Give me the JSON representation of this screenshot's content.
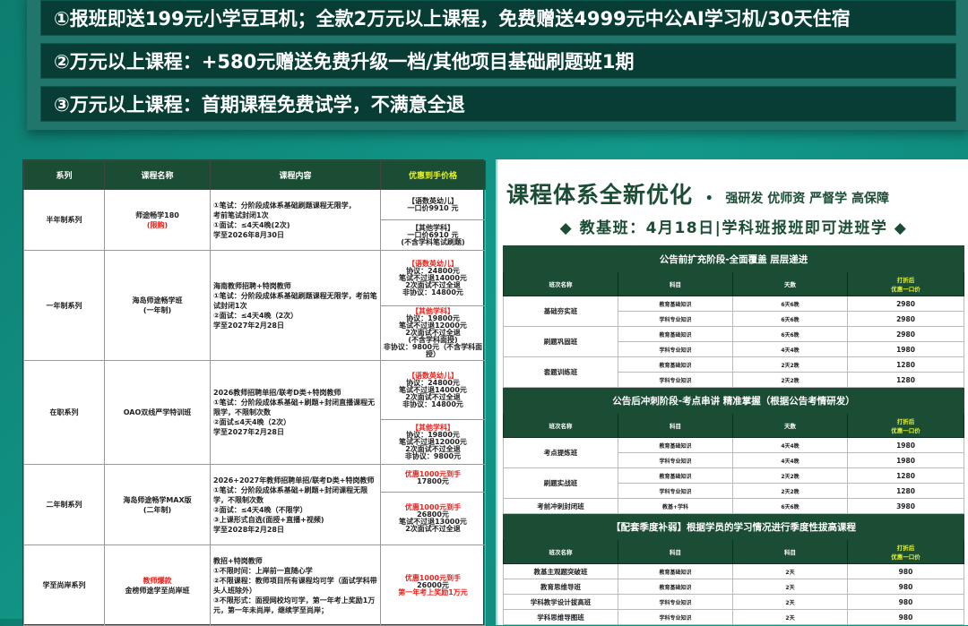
{
  "promo": [
    "①报班即送199元小学豆耳机；全款2万元以上课程，免费赠送4999元中公AI学习机/30天住宿",
    "②万元以上课程：+580元赠送免费升级一档/其他项目基础刷题班1期",
    "③万元以上课程：首期课程免费试学，不满意全退"
  ],
  "left_table": {
    "headers": [
      "系列",
      "课程名称",
      "课程内容",
      "优惠到手价格"
    ],
    "rows": [
      {
        "series": "半年制系列",
        "name": [
          "师途畅学180"
        ],
        "name_red": "(限购)",
        "content": [
          "①笔试：分阶段成体系基础刷题课程无限学，",
          "考前笔试封闭1次",
          "①面试：≤4天4晚(2次)",
          "学至2026年8月30日"
        ],
        "prices": [
          [
            {
              "t": "【语数英幼儿】"
            },
            {
              "t": "一口价9910 元"
            }
          ],
          [
            {
              "t": "【其他学科】"
            },
            {
              "t": "一口价6910 元"
            },
            {
              "t": "(不含学科笔试刷题)"
            }
          ]
        ]
      },
      {
        "series": "一年制系列",
        "name": [
          "海岛师途畅学班",
          "(一年制)"
        ],
        "content": [
          "海南教师招聘+特岗教师",
          "①笔试：分阶段成体系基础刷题课程无限学，考前笔试封闭1次",
          "②面试：≤4天4晚（2次）",
          "学至2027年2月28日"
        ],
        "prices": [
          [
            {
              "t": "【语数英幼儿】",
              "red": true
            },
            {
              "t": "协议：24800元"
            },
            {
              "t": "笔试不过退14000元"
            },
            {
              "t": "2次面试不过全退"
            },
            {
              "t": "非协议：14800元"
            }
          ],
          [
            {
              "t": "【其他学科】",
              "red": true
            },
            {
              "t": "协议：19800元"
            },
            {
              "t": "笔试不过退12000元"
            },
            {
              "t": "2次面试不过全退"
            },
            {
              "t": "(不含学科面授)"
            },
            {
              "t": "非协议：9800元（不含学科面授）"
            }
          ]
        ]
      },
      {
        "series": "在职系列",
        "name": [
          "OAO双线严学特训班"
        ],
        "content": [
          "2026教师招聘单招/联考D类+特岗教师",
          "①笔试：分阶段成体系基础+刷题+封闭直播课程无限学，不限制次数",
          "②面试≤4天4晚（2次）",
          "学至2027年2月28日"
        ],
        "prices": [
          [
            {
              "t": "【语数英幼儿】",
              "red": true
            },
            {
              "t": "协议：24800元"
            },
            {
              "t": "笔试不过退14000元"
            },
            {
              "t": "2次面试不过全退"
            },
            {
              "t": "非协议：14800元"
            }
          ],
          [
            {
              "t": "【其他学科】",
              "red": true
            },
            {
              "t": "协议：19800元"
            },
            {
              "t": "笔试不过退12000元"
            },
            {
              "t": "2次面试不过全退"
            },
            {
              "t": "非协议：9800元"
            }
          ]
        ]
      },
      {
        "series": "二年制系列",
        "name": [
          "海岛师途畅学MAX版",
          "(二年制)"
        ],
        "content": [
          "2026+2027年教师招聘单招/联考D类+特岗教师",
          "①笔试：分阶段成体系基础+刷题+封闭课程无限学，不限制次数",
          "②面试：≤4天4晚（不限学）",
          "③上课形式自选(面授+直播+视频)",
          "学至2028年2月28日"
        ],
        "prices": [
          [
            {
              "t": "优惠1000元到手",
              "red": true
            },
            {
              "t": "17800元"
            }
          ],
          [
            {
              "t": "优惠1000元到手",
              "red": true
            },
            {
              "t": "26800元"
            },
            {
              "t": "笔试不过退13000元"
            },
            {
              "t": "2次面试不过全退"
            }
          ]
        ]
      },
      {
        "series": "学至尚岸系列",
        "name_red_top": "教师爆款",
        "name": [
          "金榜师途学至尚岸班"
        ],
        "content": [
          "教招+特岗教师",
          "①不限时间：上岸前一直随心学",
          "②不限课程：教师项目所有课程均可学（面试学科带头人班除外）",
          "③不限形式：面授网校均可学，第一年考上奖励1万元，第一年未尚岸，继续学至尚岸；"
        ],
        "prices": [
          [
            {
              "t": "优惠1000元到手",
              "red": true
            },
            {
              "t": "26000元"
            },
            {
              "t": "第一年考上奖励1万元",
              "red": true
            }
          ]
        ]
      }
    ]
  },
  "right": {
    "title": "课程体系全新优化",
    "title_dot": "•",
    "tagline": "强研发  优师资  严督学 高保障",
    "subtitle": "◆ 教基班：4月18日|学科班报班即可进班学 ◆",
    "sections": [
      {
        "title": "公告前扩充阶段-全面覆盖  层层递进",
        "headers": [
          "班次名称",
          "科目",
          "天数",
          "打折后\n优惠一口价"
        ],
        "groups": [
          {
            "name": "基础夯实班",
            "rows": [
              [
                "教育基础知识",
                "6天6晚",
                "2980"
              ],
              [
                "学科专业知识",
                "6天6晚",
                "2980"
              ]
            ]
          },
          {
            "name": "刷题巩固班",
            "rows": [
              [
                "教育基础知识",
                "6天6晚",
                "2980"
              ],
              [
                "学科专业知识",
                "4天4晚",
                "1980"
              ]
            ]
          },
          {
            "name": "套题训练班",
            "rows": [
              [
                "教育基础知识",
                "2天2晚",
                "1280"
              ],
              [
                "学科专业知识",
                "2天2晚",
                "1280"
              ]
            ]
          }
        ]
      },
      {
        "title": "公告后冲刺阶段-考点串讲  精准掌握（根据公告考情研发）",
        "headers": [
          "班次名称",
          "科目",
          "天数",
          "打折后\n优惠一口价"
        ],
        "groups": [
          {
            "name": "考点提炼班",
            "rows": [
              [
                "教育基础知识",
                "4天4晚",
                "1980"
              ],
              [
                "学科专业知识",
                "4天4晚",
                "1980"
              ]
            ]
          },
          {
            "name": "刷题实战班",
            "rows": [
              [
                "教育基础知识",
                "2天2晚",
                "1280"
              ],
              [
                "学科专业知识",
                "2天2晚",
                "1280"
              ]
            ]
          },
          {
            "name": "考前冲刺封闭班",
            "rows": [
              [
                "教基+学科",
                "6天6晚",
                "3980"
              ]
            ]
          }
        ]
      },
      {
        "title": "【配套季度补弱】根据学员的学习情况进行季度性拔高课程",
        "headers": [
          "班次名称",
          "科目",
          "科目",
          "打折后\n优惠一口价"
        ],
        "groups": [
          {
            "name": "教基主观题突破班",
            "rows": [
              [
                "教育基础知识",
                "2天",
                "980"
              ]
            ]
          },
          {
            "name": "教育思维导班",
            "rows": [
              [
                "教育基础知识",
                "2天",
                "980"
              ]
            ]
          },
          {
            "name": "学科教学设计拔高班",
            "rows": [
              [
                "学科专业知识",
                "2天",
                "980"
              ]
            ]
          },
          {
            "name": "学科思维导图班",
            "rows": [
              [
                "学科专业知识",
                "2天",
                "980"
              ]
            ]
          }
        ]
      }
    ]
  },
  "colors": {
    "brand_green": "#1b4d34",
    "accent_yellow": "#e5f22a",
    "red": "#e8231c",
    "bg_teal": "#0e8a7a"
  }
}
